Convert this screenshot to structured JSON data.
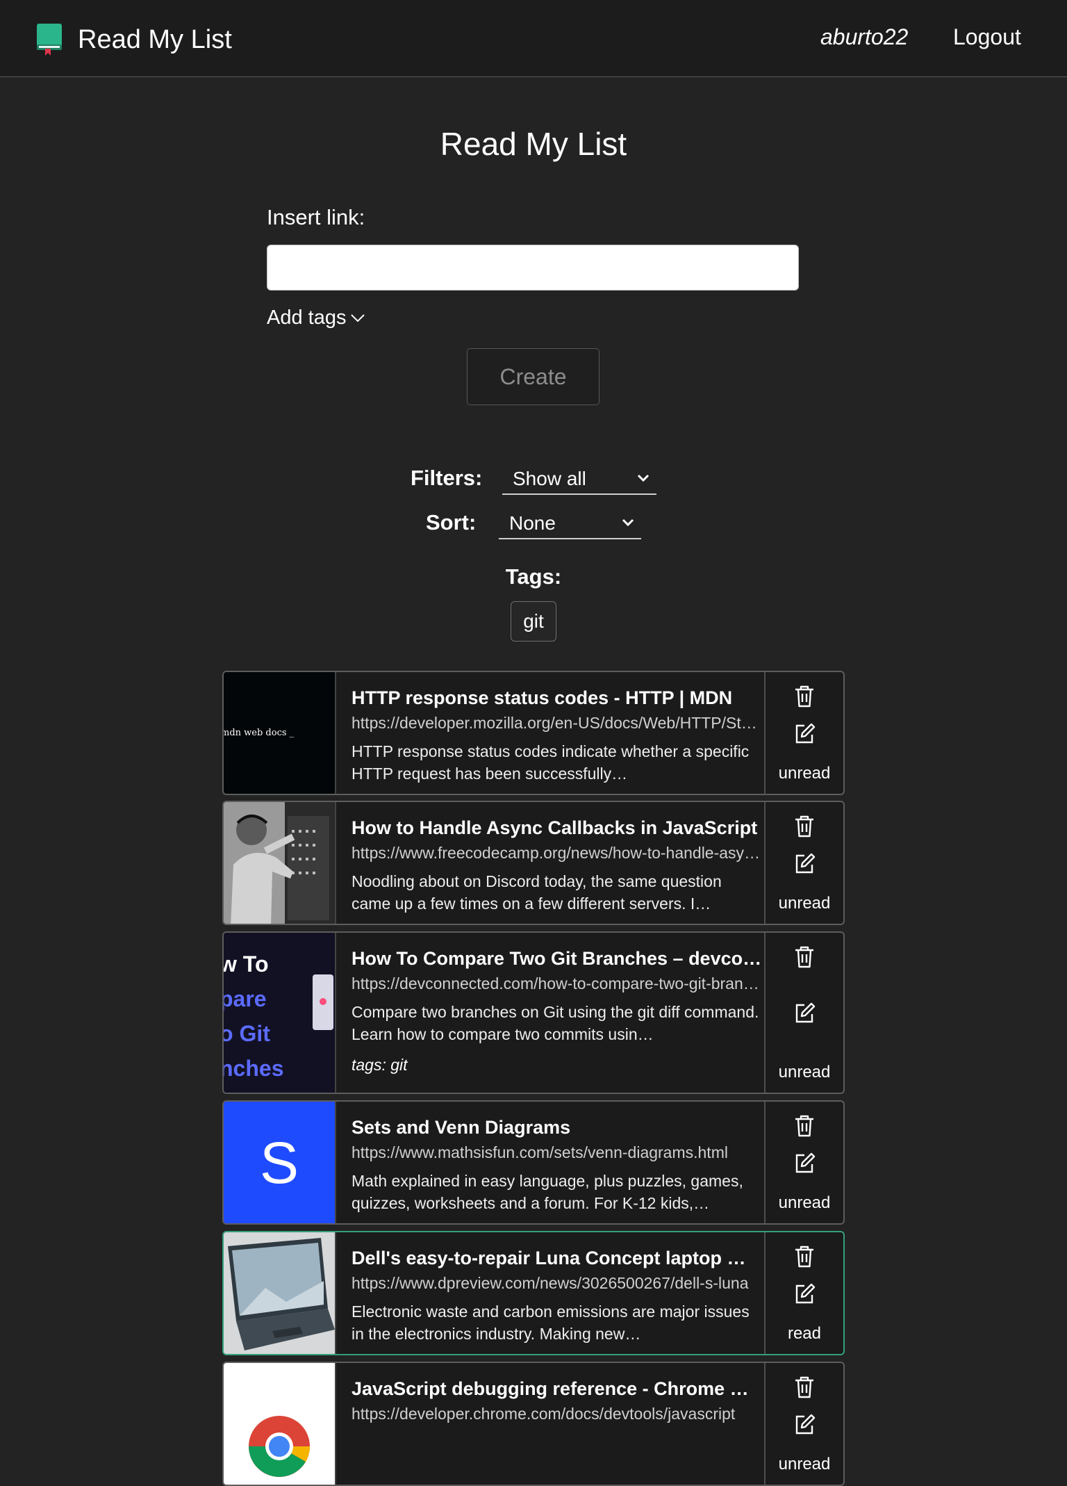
{
  "navbar": {
    "brand_title": "Read My List",
    "username": "aburto22",
    "logout_label": "Logout"
  },
  "form": {
    "page_title": "Read My List",
    "insert_label": "Insert link:",
    "link_value": "",
    "add_tags_label": "Add tags",
    "create_label": "Create"
  },
  "controls": {
    "filters_label": "Filters:",
    "filters_value": "Show all",
    "sort_label": "Sort:",
    "sort_value": "None",
    "tags_label": "Tags:",
    "tags": [
      "git"
    ]
  },
  "cards": [
    {
      "title": "HTTP response status codes - HTTP | MDN",
      "url": "https://developer.mozilla.org/en-US/docs/Web/HTTP/Status",
      "description": "HTTP response status codes indicate whether a specific HTTP request has been successfully…",
      "thumb_text": "mdn web docs _",
      "status": "unread"
    },
    {
      "title": "How to Handle Async Callbacks in JavaScript",
      "url": "https://www.freecodecamp.org/news/how-to-handle-async-callbacks",
      "description": "Noodling about on Discord today, the same question came up a few times on a few different servers. I…",
      "status": "unread"
    },
    {
      "title": "How To Compare Two Git Branches – devconnected",
      "url": "https://devconnected.com/how-to-compare-two-git-branches",
      "description": "Compare two branches on Git using the git diff command. Learn how to compare two commits usin…",
      "tags_text": "tags: git",
      "thumb_lines": [
        "w To",
        "pare",
        "o Git",
        "nches"
      ],
      "status": "unread"
    },
    {
      "title": "Sets and Venn Diagrams",
      "url": "https://www.mathsisfun.com/sets/venn-diagrams.html",
      "description": "Math explained in easy language, plus puzzles, games, quizzes, worksheets and a forum. For K-12 kids,…",
      "thumb_text": "S",
      "status": "unread"
    },
    {
      "title": "Dell's easy-to-repair Luna Concept laptop …",
      "url": "https://www.dpreview.com/news/3026500267/dell-s-luna",
      "description": "Electronic waste and carbon emissions are major issues in the electronics industry. Making new…",
      "status": "read"
    },
    {
      "title": "JavaScript debugging reference - Chrome …",
      "url": "https://developer.chrome.com/docs/devtools/javascript",
      "description": "",
      "status": "unread"
    }
  ],
  "colors": {
    "background": "#232323",
    "navbar": "#1c1c1c",
    "brand_icon": "#2bb58a",
    "read_border": "#35a07a",
    "venn_blue": "#1f4bff"
  }
}
